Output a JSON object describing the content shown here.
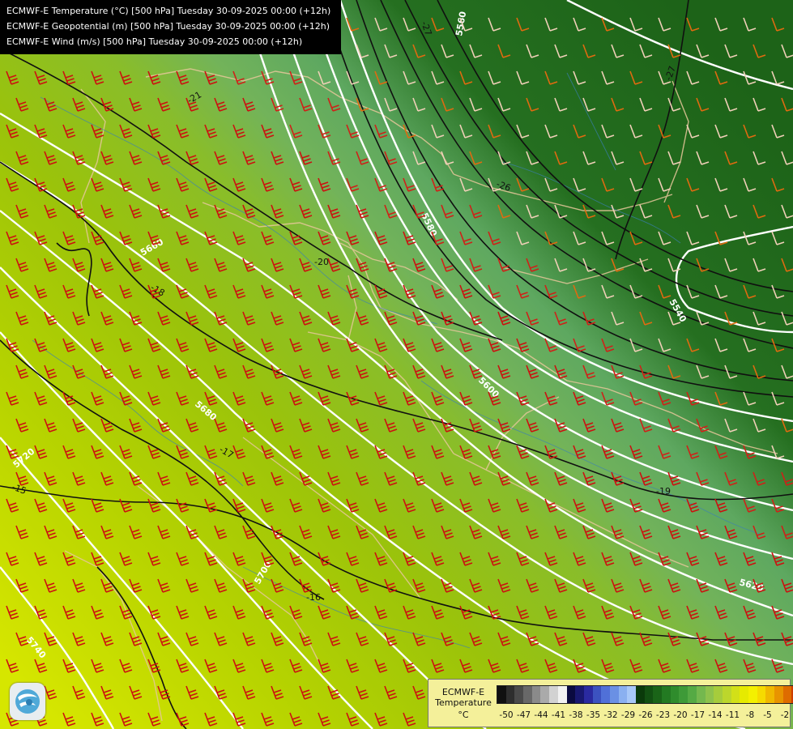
{
  "header": {
    "lines": [
      "ECMWF-E Temperature (°C) [500 hPa] Tuesday 30-09-2025 00:00 (+12h)",
      "ECMWF-E Geopotential (m) [500 hPa] Tuesday 30-09-2025 00:00 (+12h)",
      "ECMWF-E Wind (m/s) [500 hPa] Tuesday 30-09-2025 00:00 (+12h)"
    ]
  },
  "legend": {
    "title_line1": "ECMWF-E",
    "title_line2": "Temperature",
    "unit": "°C",
    "ticks": [
      "-50",
      "-47",
      "-44",
      "-41",
      "-38",
      "-35",
      "-32",
      "-29",
      "-26",
      "-23",
      "-20",
      "-17",
      "-14",
      "-11",
      "-8",
      "-5",
      "-2"
    ],
    "colors": [
      "#101010",
      "#2e2e2e",
      "#4a4a4a",
      "#686868",
      "#8a8a8a",
      "#aaaaaa",
      "#d2d2d2",
      "#f2f2f2",
      "#0a0a40",
      "#181870",
      "#2a2aa0",
      "#3c52c0",
      "#5070d8",
      "#6a90e4",
      "#8ab0f0",
      "#a8c8f8",
      "#0a3a0a",
      "#125012",
      "#1a6418",
      "#237a22",
      "#2f8c2c",
      "#3e9a38",
      "#55aa44",
      "#74b84e",
      "#8ec24c",
      "#a6cc3c",
      "#bcd62c",
      "#d2e018",
      "#e6ea00",
      "#f4f000",
      "#f6da00",
      "#f0b800",
      "#e89400",
      "#de6c00",
      "#cc3c00",
      "#b81818",
      "#a000a0",
      "#8a00c0",
      "#6a00a8",
      "#4e0090",
      "#34006a"
    ]
  },
  "map": {
    "isotherm_labels": [
      "-27",
      "-27",
      "-26",
      "-21",
      "-20",
      "-19",
      "-18",
      "-17",
      "-16",
      "-15"
    ],
    "height_labels": [
      "5540",
      "5560",
      "5580",
      "5600",
      "5620",
      "5660",
      "5680",
      "5700",
      "5720",
      "5740"
    ]
  }
}
